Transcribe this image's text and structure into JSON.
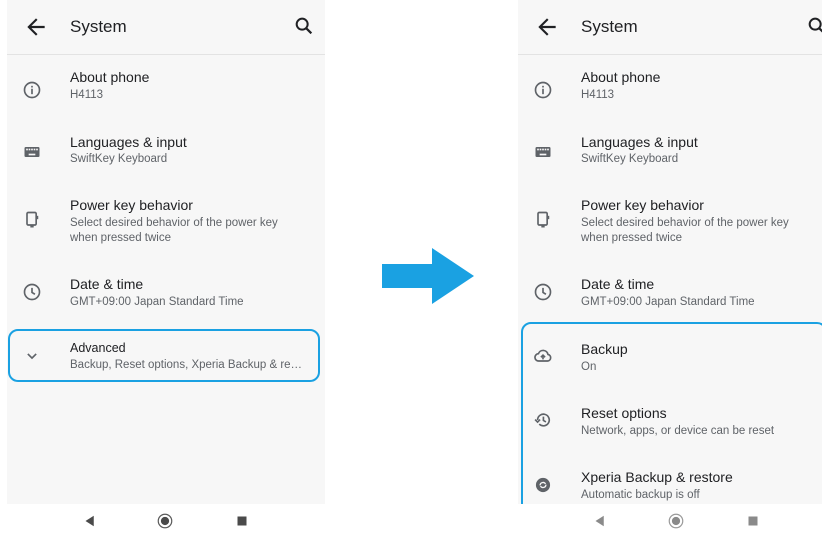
{
  "colors": {
    "accent": "#1aa1e2",
    "background": "#f7f7f7",
    "text": "#202124",
    "subtext": "#5f6368"
  },
  "left": {
    "header": {
      "title": "System",
      "back_icon": "back-arrow-icon",
      "search_icon": "search-icon"
    },
    "items": [
      {
        "icon": "info-icon",
        "title": "About phone",
        "subtitle": "H4113"
      },
      {
        "icon": "keyboard-icon",
        "title": "Languages & input",
        "subtitle": "SwiftKey Keyboard"
      },
      {
        "icon": "power-key-icon",
        "title": "Power key behavior",
        "subtitle": "Select desired behavior of the power key when pressed twice"
      },
      {
        "icon": "clock-icon",
        "title": "Date & time",
        "subtitle": "GMT+09:00 Japan Standard Time"
      },
      {
        "icon": "chevron-down-icon",
        "title": "Advanced",
        "subtitle": "Backup, Reset options, Xperia Backup & restore"
      }
    ]
  },
  "right": {
    "header": {
      "title": "System",
      "back_icon": "back-arrow-icon",
      "search_icon": "search-icon"
    },
    "items": [
      {
        "icon": "info-icon",
        "title": "About phone",
        "subtitle": "H4113"
      },
      {
        "icon": "keyboard-icon",
        "title": "Languages & input",
        "subtitle": "SwiftKey Keyboard"
      },
      {
        "icon": "power-key-icon",
        "title": "Power key behavior",
        "subtitle": "Select desired behavior of the power key when pressed twice"
      },
      {
        "icon": "clock-icon",
        "title": "Date & time",
        "subtitle": "GMT+09:00 Japan Standard Time"
      },
      {
        "icon": "cloud-upload-icon",
        "title": "Backup",
        "subtitle": "On"
      },
      {
        "icon": "restore-icon",
        "title": "Reset options",
        "subtitle": "Network, apps, or device can be reset"
      },
      {
        "icon": "xperia-backup-icon",
        "title": "Xperia Backup & restore",
        "subtitle": "Automatic backup is off"
      }
    ]
  },
  "navbar": {
    "back": "nav-back-icon",
    "home": "nav-home-icon",
    "recents": "nav-recents-icon"
  },
  "transition_arrow": "right-arrow-icon"
}
